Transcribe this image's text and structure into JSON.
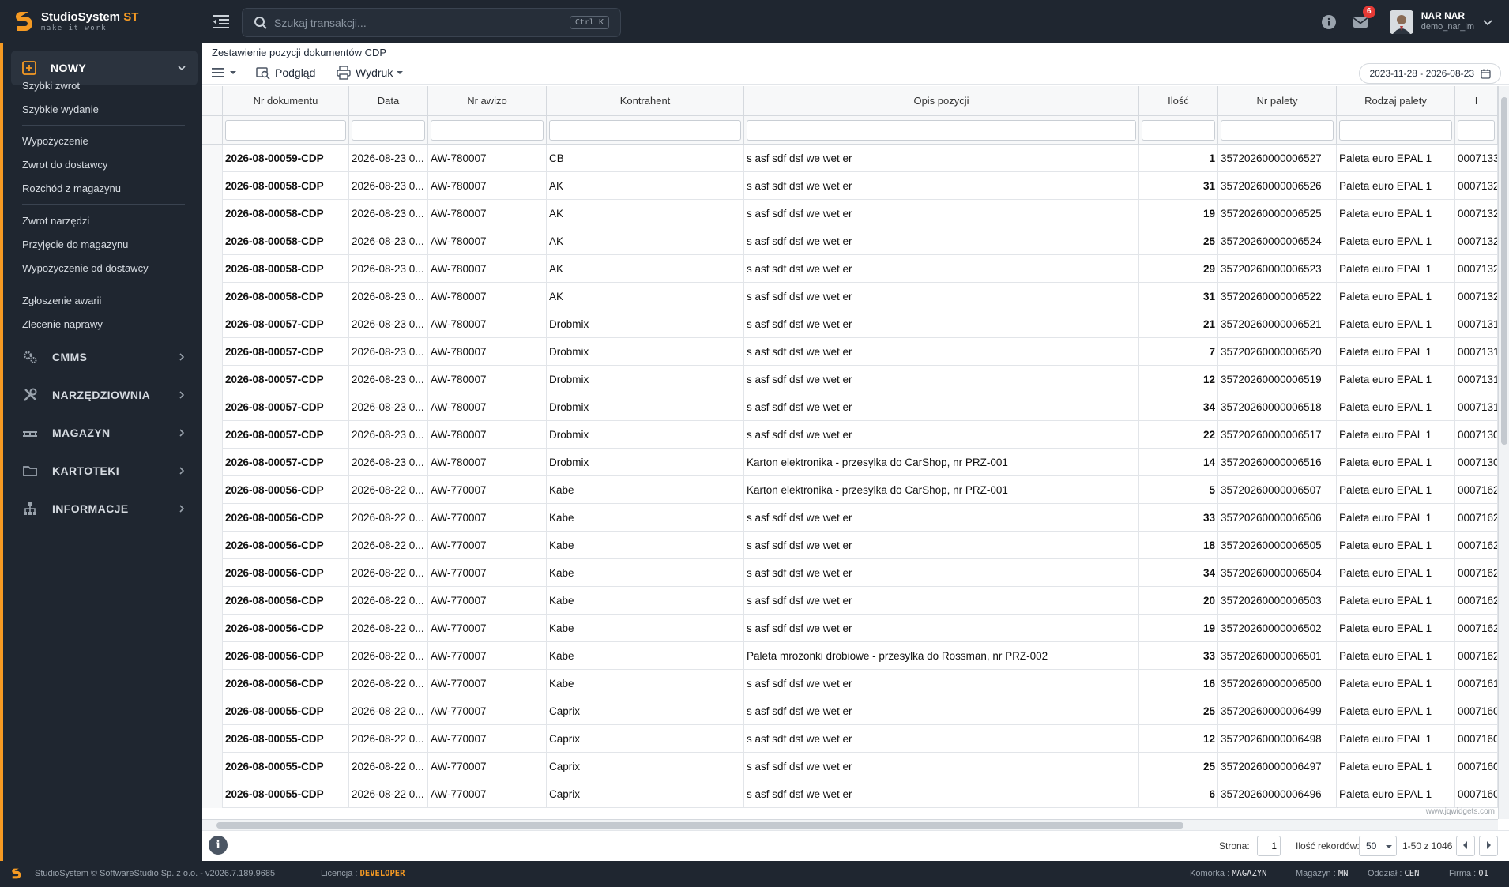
{
  "app": {
    "title_main": "StudioSystem",
    "title_accent": "ST",
    "tagline": "make it work"
  },
  "search": {
    "placeholder": "Szukaj transakcji...",
    "shortcut": "Ctrl K"
  },
  "header": {
    "notifications_count": "6",
    "user_name": "NAR NAR",
    "user_login": "demo_nar_im"
  },
  "sidebar": {
    "nowy_label": "NOWY",
    "nowy_items": [
      "Szybki zwrot",
      "Szybkie wydanie",
      "Wypożyczenie",
      "Zwrot do dostawcy",
      "Rozchód z magazynu",
      "Zwrot narzędzi",
      "Przyjęcie do magazynu",
      "Wypożyczenie od dostawcy",
      "Zgłoszenie awarii",
      "Zlecenie naprawy"
    ],
    "sections": [
      "CMMS",
      "NARZĘDZIOWNIA",
      "MAGAZYN",
      "KARTOTEKI",
      "INFORMACJE"
    ]
  },
  "page": {
    "title": "Zestawienie pozycji dokumentów CDP",
    "preview_label": "Podgląd",
    "print_label": "Wydruk",
    "date_range": "2023-11-28 - 2026-08-23"
  },
  "grid": {
    "columns": [
      "Nr dokumentu",
      "Data",
      "Nr awizo",
      "Kontrahent",
      "Opis pozycji",
      "Ilość",
      "Nr palety",
      "Rodzaj palety",
      "I"
    ],
    "rows": [
      [
        "2026-08-00059-CDP",
        "2026-08-23 0...",
        "AW-780007",
        "CB",
        "s asf sdf dsf we wet er",
        "1",
        "35720260000006527",
        "Paleta euro EPAL 1",
        "0007133"
      ],
      [
        "2026-08-00058-CDP",
        "2026-08-23 0...",
        "AW-780007",
        "AK",
        "s asf sdf dsf we wet er",
        "31",
        "35720260000006526",
        "Paleta euro EPAL 1",
        "0007132"
      ],
      [
        "2026-08-00058-CDP",
        "2026-08-23 0...",
        "AW-780007",
        "AK",
        "s asf sdf dsf we wet er",
        "19",
        "35720260000006525",
        "Paleta euro EPAL 1",
        "0007132"
      ],
      [
        "2026-08-00058-CDP",
        "2026-08-23 0...",
        "AW-780007",
        "AK",
        "s asf sdf dsf we wet er",
        "25",
        "35720260000006524",
        "Paleta euro EPAL 1",
        "0007132"
      ],
      [
        "2026-08-00058-CDP",
        "2026-08-23 0...",
        "AW-780007",
        "AK",
        "s asf sdf dsf we wet er",
        "29",
        "35720260000006523",
        "Paleta euro EPAL 1",
        "0007132"
      ],
      [
        "2026-08-00058-CDP",
        "2026-08-23 0...",
        "AW-780007",
        "AK",
        "s asf sdf dsf we wet er",
        "31",
        "35720260000006522",
        "Paleta euro EPAL 1",
        "0007132"
      ],
      [
        "2026-08-00057-CDP",
        "2026-08-23 0...",
        "AW-780007",
        "Drobmix",
        "s asf sdf dsf we wet er",
        "21",
        "35720260000006521",
        "Paleta euro EPAL 1",
        "0007131"
      ],
      [
        "2026-08-00057-CDP",
        "2026-08-23 0...",
        "AW-780007",
        "Drobmix",
        "s asf sdf dsf we wet er",
        "7",
        "35720260000006520",
        "Paleta euro EPAL 1",
        "0007131"
      ],
      [
        "2026-08-00057-CDP",
        "2026-08-23 0...",
        "AW-780007",
        "Drobmix",
        "s asf sdf dsf we wet er",
        "12",
        "35720260000006519",
        "Paleta euro EPAL 1",
        "0007131"
      ],
      [
        "2026-08-00057-CDP",
        "2026-08-23 0...",
        "AW-780007",
        "Drobmix",
        "s asf sdf dsf we wet er",
        "34",
        "35720260000006518",
        "Paleta euro EPAL 1",
        "0007131"
      ],
      [
        "2026-08-00057-CDP",
        "2026-08-23 0...",
        "AW-780007",
        "Drobmix",
        "s asf sdf dsf we wet er",
        "22",
        "35720260000006517",
        "Paleta euro EPAL 1",
        "0007130"
      ],
      [
        "2026-08-00057-CDP",
        "2026-08-23 0...",
        "AW-780007",
        "Drobmix",
        "Karton elektronika - przesylka do CarShop, nr PRZ-001",
        "14",
        "35720260000006516",
        "Paleta euro EPAL 1",
        "0007130"
      ],
      [
        "2026-08-00056-CDP",
        "2026-08-22 0...",
        "AW-770007",
        "Kabe",
        "Karton elektronika - przesylka do CarShop, nr PRZ-001",
        "5",
        "35720260000006507",
        "Paleta euro EPAL 1",
        "0007162"
      ],
      [
        "2026-08-00056-CDP",
        "2026-08-22 0...",
        "AW-770007",
        "Kabe",
        "s asf sdf dsf we wet er",
        "33",
        "35720260000006506",
        "Paleta euro EPAL 1",
        "0007162"
      ],
      [
        "2026-08-00056-CDP",
        "2026-08-22 0...",
        "AW-770007",
        "Kabe",
        "s asf sdf dsf we wet er",
        "18",
        "35720260000006505",
        "Paleta euro EPAL 1",
        "0007162"
      ],
      [
        "2026-08-00056-CDP",
        "2026-08-22 0...",
        "AW-770007",
        "Kabe",
        "s asf sdf dsf we wet er",
        "34",
        "35720260000006504",
        "Paleta euro EPAL 1",
        "0007162"
      ],
      [
        "2026-08-00056-CDP",
        "2026-08-22 0...",
        "AW-770007",
        "Kabe",
        "s asf sdf dsf we wet er",
        "20",
        "35720260000006503",
        "Paleta euro EPAL 1",
        "0007162"
      ],
      [
        "2026-08-00056-CDP",
        "2026-08-22 0...",
        "AW-770007",
        "Kabe",
        "s asf sdf dsf we wet er",
        "19",
        "35720260000006502",
        "Paleta euro EPAL 1",
        "0007162"
      ],
      [
        "2026-08-00056-CDP",
        "2026-08-22 0...",
        "AW-770007",
        "Kabe",
        "Paleta mrozonki drobiowe - przesylka do Rossman, nr PRZ-002",
        "33",
        "35720260000006501",
        "Paleta euro EPAL 1",
        "0007162"
      ],
      [
        "2026-08-00056-CDP",
        "2026-08-22 0...",
        "AW-770007",
        "Kabe",
        "s asf sdf dsf we wet er",
        "16",
        "35720260000006500",
        "Paleta euro EPAL 1",
        "0007161"
      ],
      [
        "2026-08-00055-CDP",
        "2026-08-22 0...",
        "AW-770007",
        "Caprix",
        "s asf sdf dsf we wet er",
        "25",
        "35720260000006499",
        "Paleta euro EPAL 1",
        "0007160"
      ],
      [
        "2026-08-00055-CDP",
        "2026-08-22 0...",
        "AW-770007",
        "Caprix",
        "s asf sdf dsf we wet er",
        "12",
        "35720260000006498",
        "Paleta euro EPAL 1",
        "0007160"
      ],
      [
        "2026-08-00055-CDP",
        "2026-08-22 0...",
        "AW-770007",
        "Caprix",
        "s asf sdf dsf we wet er",
        "25",
        "35720260000006497",
        "Paleta euro EPAL 1",
        "0007160"
      ],
      [
        "2026-08-00055-CDP",
        "2026-08-22 0...",
        "AW-770007",
        "Caprix",
        "s asf sdf dsf we wet er",
        "6",
        "35720260000006496",
        "Paleta euro EPAL 1",
        "0007160"
      ]
    ],
    "watermark": "www.jqwidgets.com"
  },
  "pager": {
    "page_label": "Strona:",
    "page_value": "1",
    "records_label": "Ilość rekordów:",
    "records_value": "50",
    "range_text": "1-50 z 1046"
  },
  "status": {
    "copyright": "StudioSystem © SoftwareStudio Sp. z o.o. - v2026.7.189.9685",
    "license_label": "Licencja :",
    "license_value": "DEVELOPER",
    "cell_label": "Komórka :",
    "cell_value": "MAGAZYN",
    "warehouse_label": "Magazyn :",
    "warehouse_value": "MN",
    "branch_label": "Oddział :",
    "branch_value": "CEN",
    "company_label": "Firma :",
    "company_value": "01"
  },
  "colors": {
    "accent": "#f59a23",
    "dark": "#1f2630",
    "badge": "#e53935"
  }
}
